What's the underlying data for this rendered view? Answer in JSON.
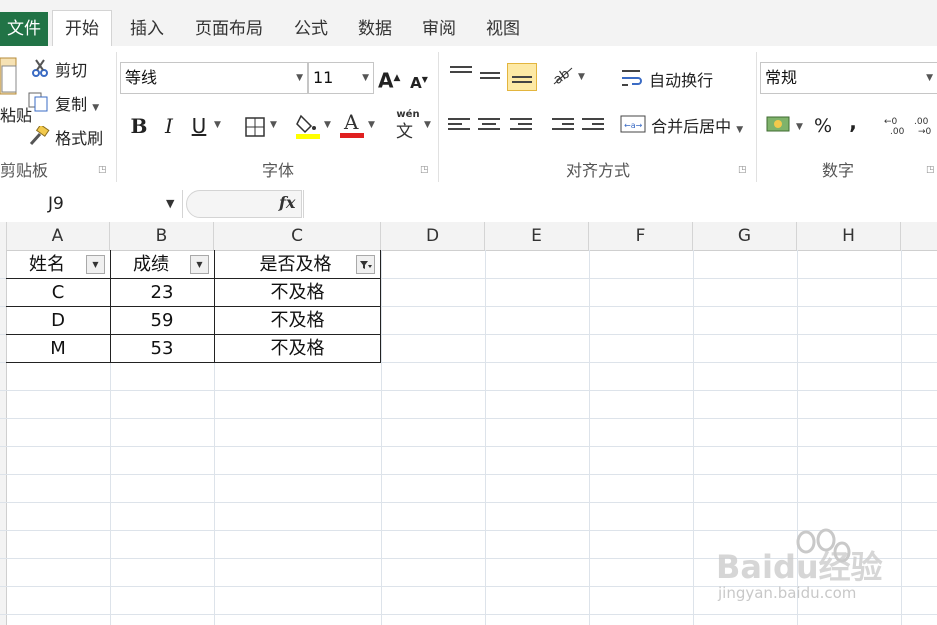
{
  "tabs": {
    "file": "文件",
    "items": [
      "开始",
      "插入",
      "页面布局",
      "公式",
      "数据",
      "审阅",
      "视图"
    ],
    "active": "开始"
  },
  "ribbon": {
    "clipboard": {
      "label": "剪贴板",
      "paste": "粘贴",
      "cut": "剪切",
      "copy": "复制",
      "format_painter": "格式刷"
    },
    "font": {
      "label": "字体",
      "font_name": "等线",
      "font_size": "11",
      "bold": "B",
      "italic": "I",
      "underline": "U",
      "grow": "A",
      "shrink": "A",
      "font_color": "#e02020",
      "fill_color": "#ffff00",
      "phonetic": "wén"
    },
    "alignment": {
      "label": "对齐方式",
      "wrap_text": "自动换行",
      "merge_center": "合并后居中"
    },
    "number": {
      "label": "数字",
      "format": "常规",
      "percent": "%",
      "comma": ","
    }
  },
  "formula_bar": {
    "name_box": "J9",
    "fx": "fx",
    "content": ""
  },
  "columns": [
    "A",
    "B",
    "C",
    "D",
    "E",
    "F",
    "G",
    "H"
  ],
  "table": {
    "headers": [
      "姓名",
      "成绩",
      "是否及格"
    ],
    "rows": [
      [
        "C",
        "23",
        "不及格"
      ],
      [
        "D",
        "59",
        "不及格"
      ],
      [
        "M",
        "53",
        "不及格"
      ]
    ]
  },
  "watermark": {
    "text": "Baidu经验",
    "url": "jingyan.baidu.com"
  },
  "colors": {
    "accent": "#217346",
    "grid": "#dde3ea",
    "highlight": "#fde9a5"
  }
}
